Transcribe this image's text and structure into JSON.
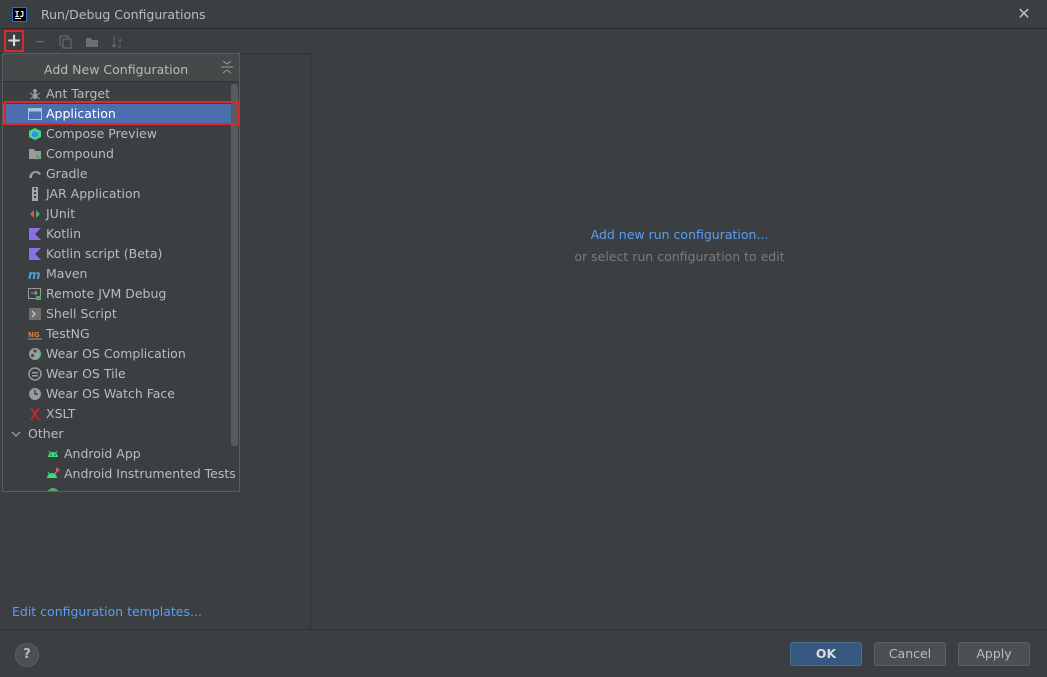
{
  "window": {
    "title": "Run/Debug Configurations",
    "logo_text": "IJ"
  },
  "toolbar": {
    "add_symbol": "+",
    "remove_symbol": "−"
  },
  "popup": {
    "title": "Add New Configuration",
    "items": [
      {
        "label": "Ant Target",
        "icon": "ant-icon"
      },
      {
        "label": "Application",
        "icon": "application-icon",
        "selected": true
      },
      {
        "label": "Compose Preview",
        "icon": "compose-icon"
      },
      {
        "label": "Compound",
        "icon": "compound-icon"
      },
      {
        "label": "Gradle",
        "icon": "gradle-icon"
      },
      {
        "label": "JAR Application",
        "icon": "jar-icon"
      },
      {
        "label": "JUnit",
        "icon": "junit-icon"
      },
      {
        "label": "Kotlin",
        "icon": "kotlin-icon"
      },
      {
        "label": "Kotlin script (Beta)",
        "icon": "kotlin-script-icon"
      },
      {
        "label": "Maven",
        "icon": "maven-icon"
      },
      {
        "label": "Remote JVM Debug",
        "icon": "remote-debug-icon"
      },
      {
        "label": "Shell Script",
        "icon": "shell-icon"
      },
      {
        "label": "TestNG",
        "icon": "testng-icon"
      },
      {
        "label": "Wear OS Complication",
        "icon": "wear-complication-icon"
      },
      {
        "label": "Wear OS Tile",
        "icon": "wear-tile-icon"
      },
      {
        "label": "Wear OS Watch Face",
        "icon": "wear-watchface-icon"
      },
      {
        "label": "XSLT",
        "icon": "xslt-icon"
      }
    ],
    "group": {
      "label": "Other",
      "icon": "chevron-down-icon"
    },
    "group_items": [
      {
        "label": "Android App",
        "icon": "android-icon"
      },
      {
        "label": "Android Instrumented Tests",
        "icon": "android-test-icon"
      }
    ]
  },
  "right_panel": {
    "link": "Add new run configuration...",
    "hint": "or select run configuration to edit"
  },
  "left_panel": {
    "edit_templates": "Edit configuration templates..."
  },
  "footer": {
    "help": "?",
    "ok": "OK",
    "cancel": "Cancel",
    "apply": "Apply"
  },
  "colors": {
    "background": "#3c3f41",
    "selection": "#4b6eaf",
    "link": "#589df6",
    "highlight_outline": "#e0252b"
  }
}
